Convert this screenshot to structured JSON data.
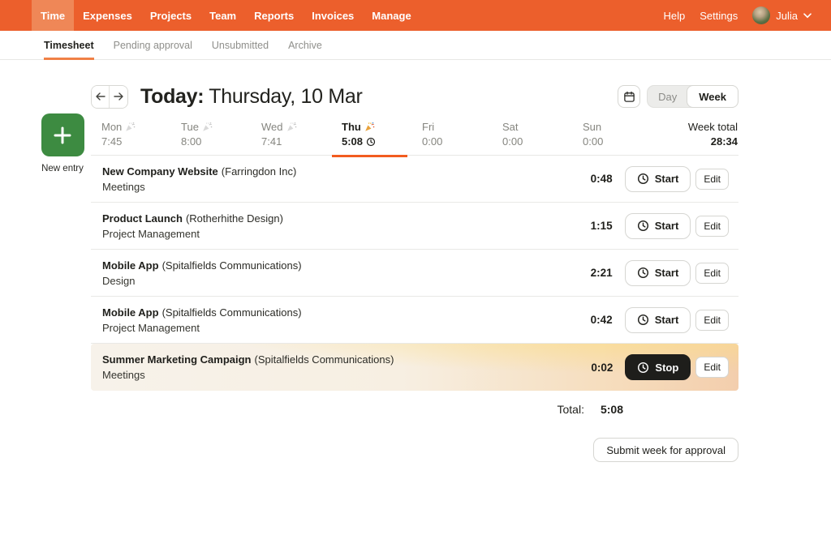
{
  "nav": {
    "items": [
      {
        "label": "Time",
        "active": true
      },
      {
        "label": "Expenses",
        "active": false
      },
      {
        "label": "Projects",
        "active": false
      },
      {
        "label": "Team",
        "active": false
      },
      {
        "label": "Reports",
        "active": false
      },
      {
        "label": "Invoices",
        "active": false
      },
      {
        "label": "Manage",
        "active": false
      }
    ],
    "help_label": "Help",
    "settings_label": "Settings",
    "user_name": "Julia"
  },
  "tabs": [
    {
      "label": "Timesheet",
      "active": true
    },
    {
      "label": "Pending approval",
      "active": false
    },
    {
      "label": "Unsubmitted",
      "active": false
    },
    {
      "label": "Archive",
      "active": false
    }
  ],
  "header": {
    "title_prefix": "Today:",
    "title_date": "Thursday, 10 Mar",
    "view_day": "Day",
    "view_week": "Week",
    "active_view": "Week"
  },
  "week": {
    "days": [
      {
        "name": "Mon",
        "time": "7:45",
        "popper": true,
        "popper_muted": true,
        "active": false,
        "clock": false
      },
      {
        "name": "Tue",
        "time": "8:00",
        "popper": true,
        "popper_muted": true,
        "active": false,
        "clock": false
      },
      {
        "name": "Wed",
        "time": "7:41",
        "popper": true,
        "popper_muted": true,
        "active": false,
        "clock": false
      },
      {
        "name": "Thu",
        "time": "5:08",
        "popper": true,
        "popper_muted": false,
        "active": true,
        "clock": true
      },
      {
        "name": "Fri",
        "time": "0:00",
        "popper": false,
        "popper_muted": false,
        "active": false,
        "clock": false
      },
      {
        "name": "Sat",
        "time": "0:00",
        "popper": false,
        "popper_muted": false,
        "active": false,
        "clock": false
      },
      {
        "name": "Sun",
        "time": "0:00",
        "popper": false,
        "popper_muted": false,
        "active": false,
        "clock": false
      }
    ],
    "total_label": "Week total",
    "total_value": "28:34"
  },
  "new_entry": {
    "label": "New entry"
  },
  "rows": [
    {
      "project": "New Company Website",
      "client": "(Farringdon Inc)",
      "task": "Meetings",
      "time": "0:48",
      "running": false
    },
    {
      "project": "Product Launch",
      "client": "(Rotherhithe Design)",
      "task": "Project Management",
      "time": "1:15",
      "running": false
    },
    {
      "project": "Mobile App",
      "client": "(Spitalfields Communications)",
      "task": "Design",
      "time": "2:21",
      "running": false
    },
    {
      "project": "Mobile App",
      "client": "(Spitalfields Communications)",
      "task": "Project Management",
      "time": "0:42",
      "running": false
    },
    {
      "project": "Summer Marketing Campaign",
      "client": "(Spitalfields Communications)",
      "task": "Meetings",
      "time": "0:02",
      "running": true
    }
  ],
  "buttons": {
    "start": "Start",
    "stop": "Stop",
    "edit": "Edit",
    "submit": "Submit week for approval"
  },
  "total": {
    "label": "Total:",
    "value": "5:08"
  },
  "colors": {
    "nav_orange": "#ec5f2c",
    "nav_active_orange": "#ef8757",
    "accent_orange": "#f25c1f",
    "new_entry_green": "#3d8b41",
    "stop_button_black": "#1e1e1b",
    "running_row_left": "#f7f2ea",
    "running_row_right": "#f3cead"
  }
}
